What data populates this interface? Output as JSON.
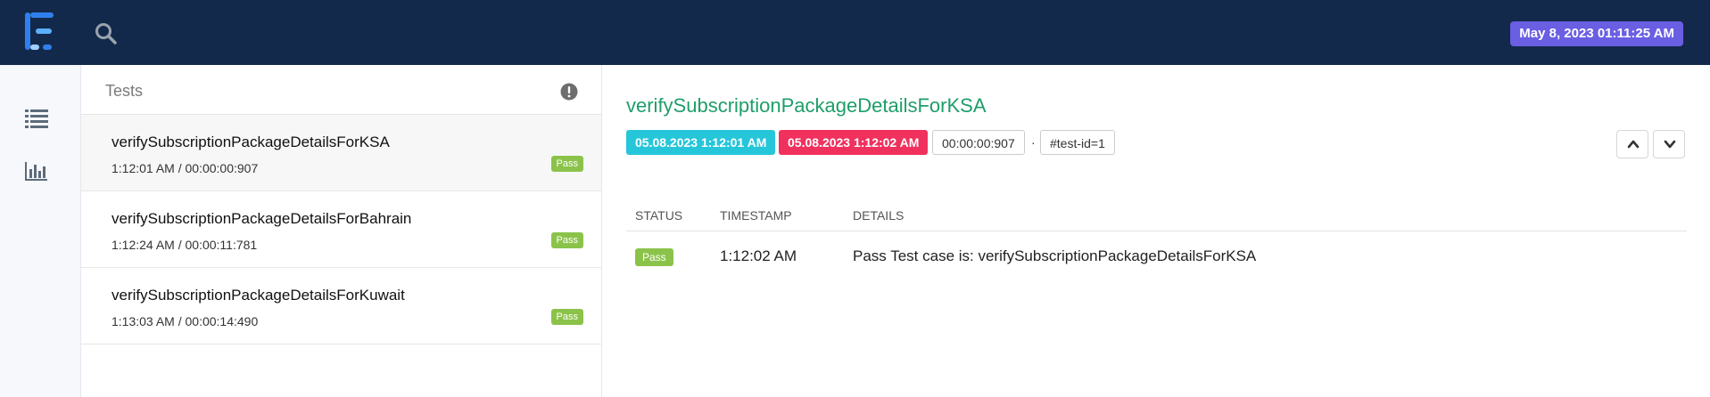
{
  "header": {
    "datetime": "May 8, 2023 01:11:25 AM",
    "logo_icon": "extent-logo-icon",
    "search_icon": "search-icon"
  },
  "sidebar": {
    "items": [
      {
        "icon": "list-icon"
      },
      {
        "icon": "bar-chart-icon"
      }
    ]
  },
  "test_list": {
    "title": "Tests",
    "tests": [
      {
        "name": "verifySubscriptionPackageDetailsForKSA",
        "meta": "1:12:01 AM / 00:00:00:907",
        "status": "Pass"
      },
      {
        "name": "verifySubscriptionPackageDetailsForBahrain",
        "meta": "1:12:24 AM / 00:00:11:781",
        "status": "Pass"
      },
      {
        "name": "verifySubscriptionPackageDetailsForKuwait",
        "meta": "1:13:03 AM / 00:00:14:490",
        "status": "Pass"
      }
    ]
  },
  "detail": {
    "title": "verifySubscriptionPackageDetailsForKSA",
    "start": "05.08.2023 1:12:01 AM",
    "end": "05.08.2023 1:12:02 AM",
    "duration": "00:00:00:907",
    "separator": "·",
    "test_id": "#test-id=1",
    "log": {
      "headers": {
        "status": "STATUS",
        "timestamp": "TIMESTAMP",
        "details": "DETAILS"
      },
      "rows": [
        {
          "status": "Pass",
          "timestamp": "1:12:02 AM",
          "details": "Pass Test case is: verifySubscriptionPackageDetailsForKSA"
        }
      ]
    }
  },
  "colors": {
    "topbar": "#13294b",
    "datetime_badge": "#6a5ee2",
    "pass": "#8bc34a",
    "start_chip": "#26c6da",
    "end_chip": "#f0315e",
    "title": "#1e9e6a"
  }
}
